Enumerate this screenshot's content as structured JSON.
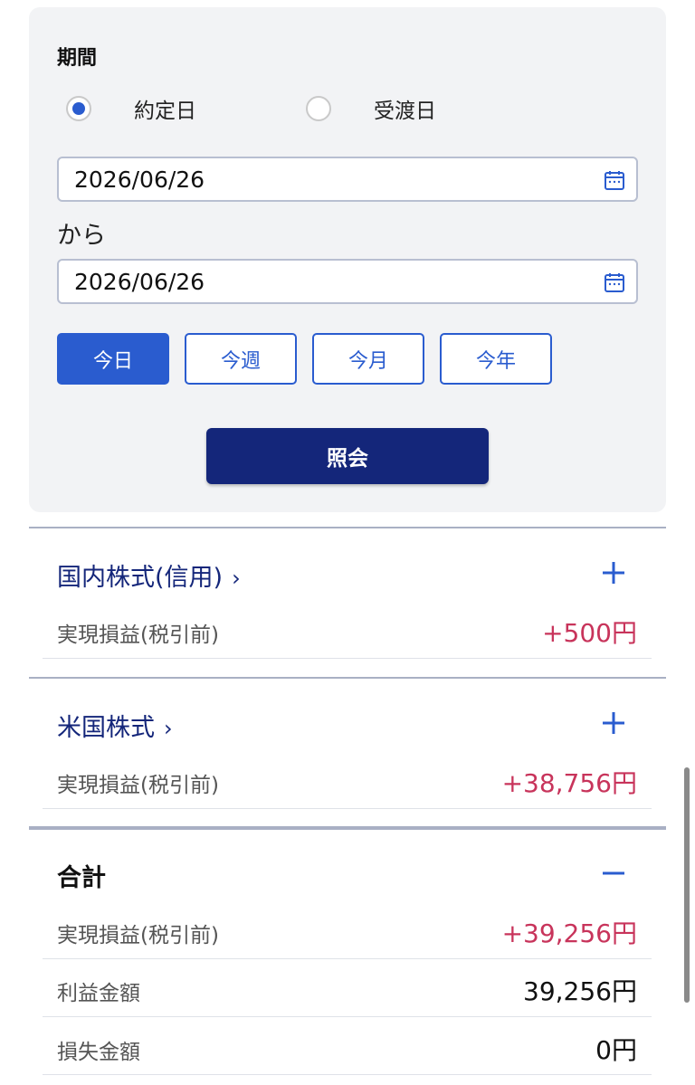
{
  "period": {
    "title": "期間",
    "radio_options": [
      {
        "label": "約定日",
        "checked": true
      },
      {
        "label": "受渡日",
        "checked": false
      }
    ],
    "from_date": "2026/06/26",
    "to_label": "から",
    "to_date": "2026/06/26",
    "quick_buttons": [
      {
        "label": "今日",
        "active": true
      },
      {
        "label": "今週",
        "active": false
      },
      {
        "label": "今月",
        "active": false
      },
      {
        "label": "今年",
        "active": false
      }
    ],
    "query_label": "照会"
  },
  "sections": [
    {
      "title": "国内株式(信用)",
      "chevron": "›",
      "toggle": "plus-icon",
      "rows": [
        {
          "label": "実現損益(税引前)",
          "value": "+500円"
        }
      ]
    },
    {
      "title": "米国株式",
      "chevron": "›",
      "toggle": "plus-icon",
      "rows": [
        {
          "label": "実現損益(税引前)",
          "value": "+38,756円"
        }
      ]
    }
  ],
  "total": {
    "title": "合計",
    "toggle": "minus-icon",
    "rows": [
      {
        "label": "実現損益(税引前)",
        "value": "+39,256円"
      },
      {
        "label": "利益金額",
        "value": "39,256円"
      },
      {
        "label": "損失金額",
        "value": "0円"
      }
    ]
  },
  "colors": {
    "accent": "#2a5ccf",
    "navy": "#14267a",
    "positive": "#c8345b",
    "panel_bg": "#f2f3f5"
  }
}
